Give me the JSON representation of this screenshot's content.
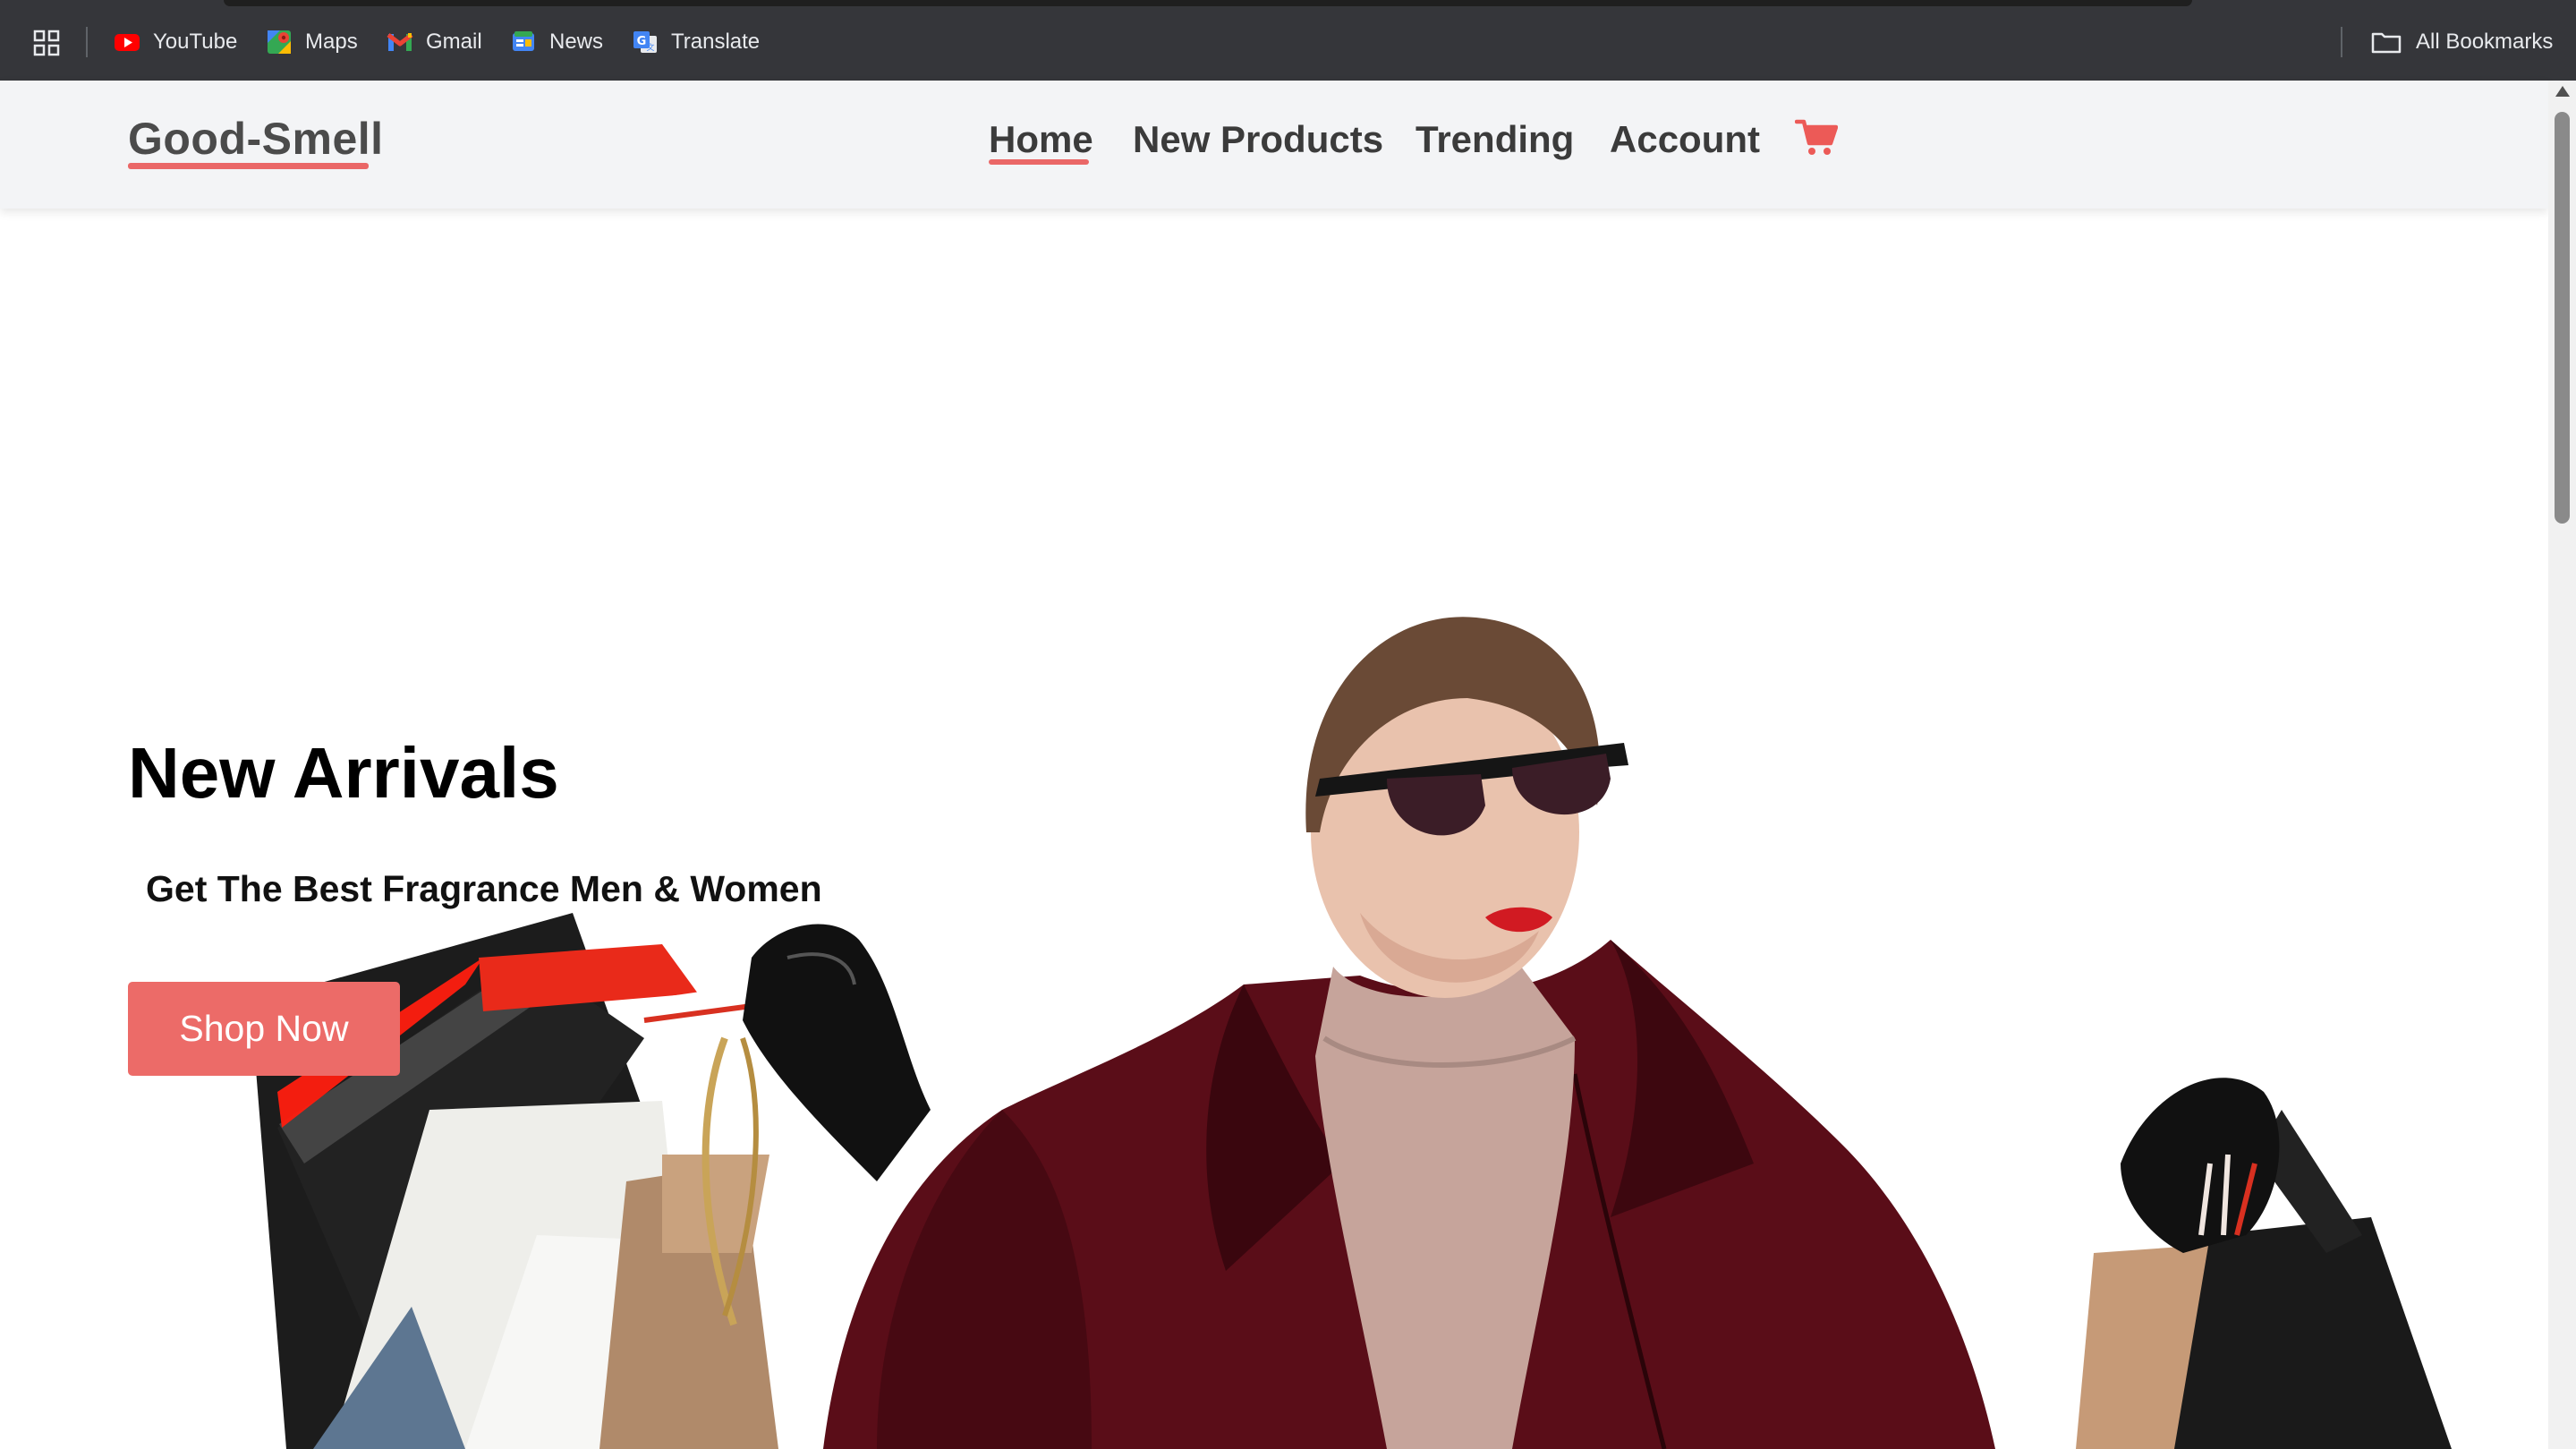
{
  "bookmarks_bar": {
    "items": [
      {
        "label": "YouTube",
        "icon": "youtube-icon"
      },
      {
        "label": "Maps",
        "icon": "maps-icon"
      },
      {
        "label": "Gmail",
        "icon": "gmail-icon"
      },
      {
        "label": "News",
        "icon": "news-icon"
      },
      {
        "label": "Translate",
        "icon": "translate-icon"
      }
    ],
    "all_bookmarks": "All Bookmarks"
  },
  "header": {
    "logo": "Good-Smell",
    "nav": [
      {
        "label": "Home",
        "active": true
      },
      {
        "label": "New Products"
      },
      {
        "label": "Trending"
      },
      {
        "label": "Account"
      }
    ],
    "cart_icon": "cart-icon"
  },
  "hero": {
    "title": "New Arrivals",
    "subtitle": "Get The Best Fragrance Men & Women",
    "button": "Shop Now",
    "image_description": "woman-with-shopping-bags"
  },
  "colors": {
    "accent": "#ec6b68",
    "header_bg": "#f3f4f6",
    "bookmarks_bg": "#35363a"
  }
}
